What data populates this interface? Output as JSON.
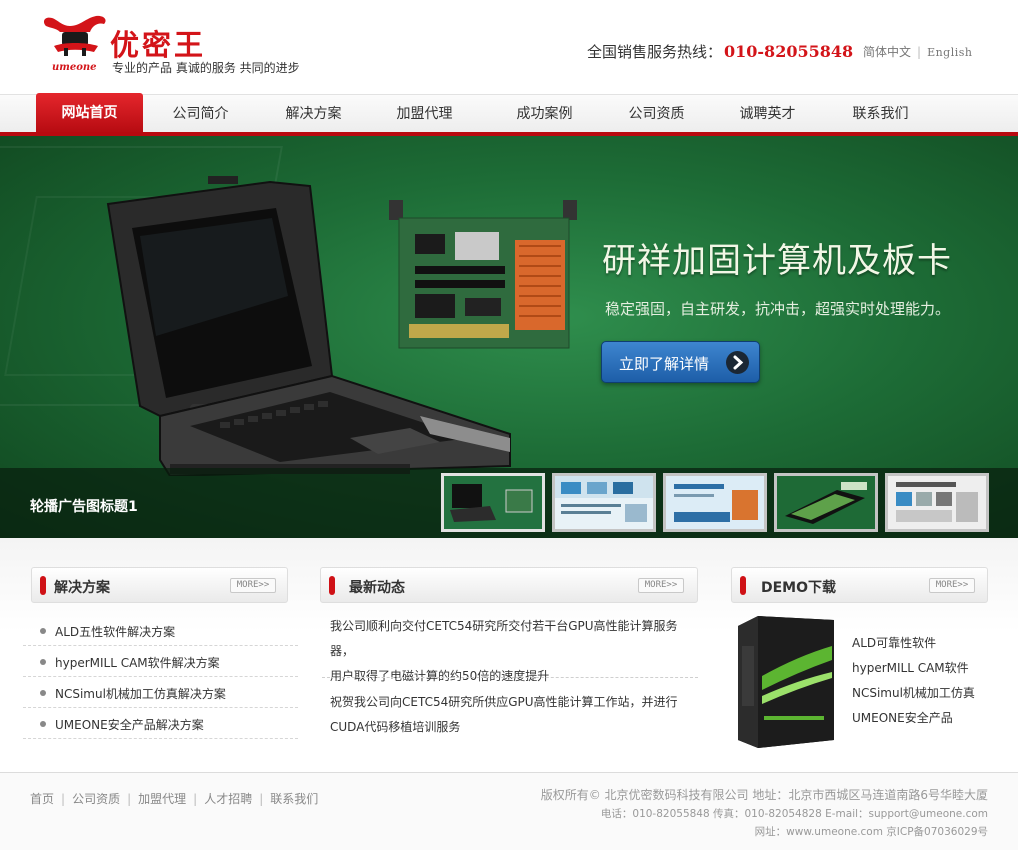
{
  "header": {
    "logo_cn": "优密王",
    "logo_en": "umeone",
    "slogan": "专业的产品 真诚的服务 共同的进步",
    "hotline_label": "全国销售服务热线：",
    "hotline_number": "010-82055848",
    "lang_cn": "简体中文",
    "lang_sep": "|",
    "lang_en": "English"
  },
  "nav": {
    "items": [
      {
        "label": "网站首页",
        "active": true
      },
      {
        "label": "公司简介"
      },
      {
        "label": "解决方案"
      },
      {
        "label": "加盟代理"
      },
      {
        "label": "成功案例"
      },
      {
        "label": "公司资质"
      },
      {
        "label": "诚聘英才"
      },
      {
        "label": "联系我们"
      }
    ]
  },
  "banner": {
    "title": "研祥加固计算机及板卡",
    "description": "稳定强固，自主研发，抗冲击，超强实时处理能力。",
    "button": "立即了解详情",
    "caption": "轮播广告图标题1",
    "thumb_count": 5
  },
  "solutions": {
    "title": "解决方案",
    "more": "MORE>>",
    "items": [
      "ALD五性软件解决方案",
      "hyperMILL CAM软件解决方案",
      "NCSimul机械加工仿真解决方案",
      "UMEONE安全产品解决方案"
    ]
  },
  "news": {
    "title": "最新动态",
    "more": "MORE>>",
    "items": [
      {
        "line1": "我公司顺利向交付CETC54研究所交付若干台GPU高性能计算服务器，",
        "line2": "用户取得了电磁计算的约50倍的速度提升"
      },
      {
        "line1": "祝贺我公司向CETC54研究所供应GPU高性能计算工作站，并进行",
        "line2": "CUDA代码移植培训服务"
      }
    ]
  },
  "demo": {
    "title": "DEMO下载",
    "more": "MORE>>",
    "items": [
      "ALD可靠性软件",
      "hyperMILL CAM软件",
      "NCSimul机械加工仿真",
      "UMEONE安全产品"
    ]
  },
  "footer": {
    "links": [
      "首页",
      "公司资质",
      "加盟代理",
      "人才招聘",
      "联系我们"
    ],
    "copyright": "版权所有© 北京优密数码科技有限公司 地址：北京市西城区马连道南路6号华睦大厦",
    "phone": "电话：010-82055848 传真：010-82054828 E-mail：support@umeone.com",
    "site": "网址：www.umeone.com 京ICP备07036029号"
  },
  "colors": {
    "brand_red": "#d31419",
    "banner_green": "#1d6c36",
    "button_blue": "#2a70bd"
  }
}
